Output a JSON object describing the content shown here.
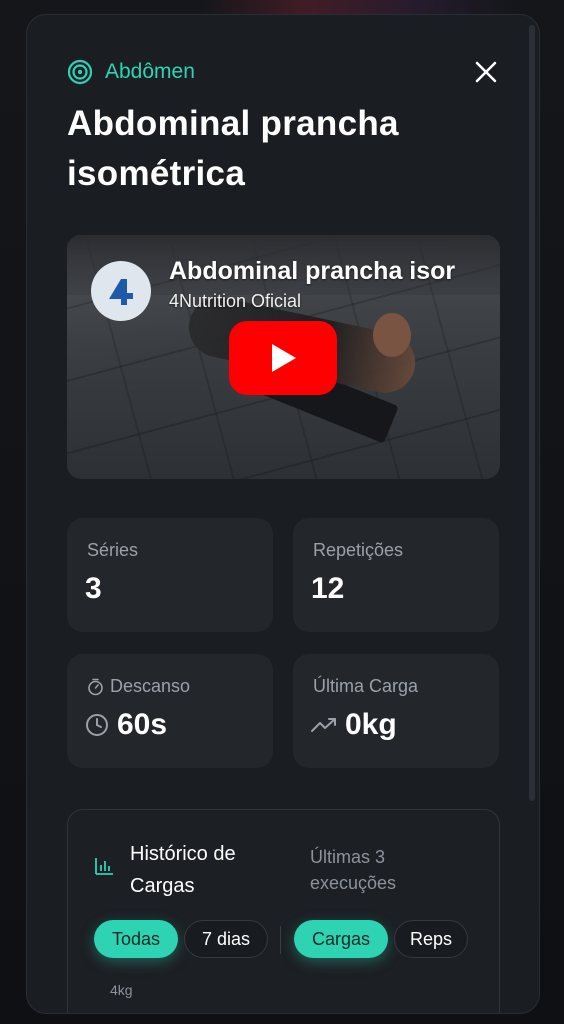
{
  "header": {
    "category": "Abdômen",
    "title": "Abdominal prancha isométrica"
  },
  "video": {
    "title": "Abdominal prancha isor",
    "channel": "4Nutrition Oficial"
  },
  "stats": {
    "series": {
      "label": "Séries",
      "value": "3"
    },
    "reps": {
      "label": "Repetições",
      "value": "12"
    },
    "rest": {
      "label": "Descanso",
      "value": "60s"
    },
    "last_load": {
      "label": "Última Carga",
      "value": "0kg"
    }
  },
  "history": {
    "title": "Histórico de Cargas",
    "subtitle": "Últimas 3 execuções",
    "filters": [
      {
        "label": "Todas",
        "active": true
      },
      {
        "label": "7 dias",
        "active": false
      }
    ],
    "metrics": [
      {
        "label": "Cargas",
        "active": true
      },
      {
        "label": "Reps",
        "active": false
      }
    ],
    "y_tick": "4kg"
  },
  "colors": {
    "accent": "#2ed3b4",
    "background": "#1a1d21",
    "card": "#23262b",
    "play": "#ff0000"
  },
  "icons": {
    "category": "target-icon",
    "close": "close-icon",
    "rest": "timer-icon",
    "rest_value": "clock-icon",
    "last_load": "trending-up-icon",
    "history": "bar-chart-icon",
    "play": "play-icon"
  }
}
